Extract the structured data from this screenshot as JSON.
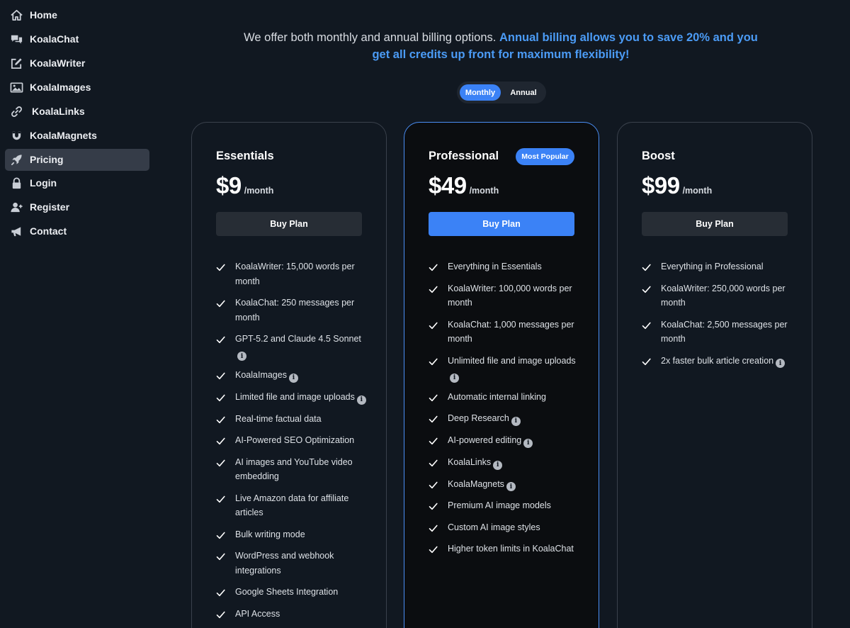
{
  "sidebar": {
    "items": [
      {
        "label": "Home",
        "icon": "home-icon"
      },
      {
        "label": "KoalaChat",
        "icon": "chat-icon"
      },
      {
        "label": "KoalaWriter",
        "icon": "edit-icon"
      },
      {
        "label": "KoalaImages",
        "icon": "image-icon"
      },
      {
        "label": "KoalaLinks",
        "icon": "link-icon"
      },
      {
        "label": "KoalaMagnets",
        "icon": "magnet-icon"
      },
      {
        "label": "Pricing",
        "icon": "rocket-icon",
        "active": true
      },
      {
        "label": "Login",
        "icon": "lock-icon"
      },
      {
        "label": "Register",
        "icon": "user-plus-icon"
      },
      {
        "label": "Contact",
        "icon": "megaphone-icon"
      }
    ]
  },
  "intro": {
    "text": "We offer both monthly and annual billing options.",
    "highlight": "Annual billing allows you to save 20% and you get all credits up front for maximum flexibility!"
  },
  "billing_toggle": {
    "monthly": "Monthly",
    "annual": "Annual",
    "selected": "Monthly"
  },
  "plans": [
    {
      "name": "Essentials",
      "price": "$9",
      "period": "/month",
      "button": "Buy Plan",
      "features": [
        {
          "text": "KoalaWriter: 15,000 words per month"
        },
        {
          "text": "KoalaChat: 250 messages per month"
        },
        {
          "text": "GPT-5.2 and Claude 4.5 Sonnet",
          "info": true
        },
        {
          "text": "KoalaImages",
          "info": true
        },
        {
          "text": "Limited file and image uploads",
          "info": true
        },
        {
          "text": "Real-time factual data"
        },
        {
          "text": "AI-Powered SEO Optimization"
        },
        {
          "text": "AI images and YouTube video embedding"
        },
        {
          "text": "Live Amazon data for affiliate articles"
        },
        {
          "text": "Bulk writing mode"
        },
        {
          "text": "WordPress and webhook integrations"
        },
        {
          "text": "Google Sheets Integration"
        },
        {
          "text": "API Access"
        }
      ]
    },
    {
      "name": "Professional",
      "badge": "Most Popular",
      "price": "$49",
      "period": "/month",
      "button": "Buy Plan",
      "features": [
        {
          "text": "Everything in Essentials"
        },
        {
          "text": "KoalaWriter: 100,000 words per month"
        },
        {
          "text": "KoalaChat: 1,000 messages per month"
        },
        {
          "text": "Unlimited file and image uploads",
          "info": true
        },
        {
          "text": "Automatic internal linking"
        },
        {
          "text": "Deep Research",
          "info": true
        },
        {
          "text": "AI-powered editing",
          "info": true
        },
        {
          "text": "KoalaLinks",
          "info": true
        },
        {
          "text": "KoalaMagnets",
          "info": true
        },
        {
          "text": "Premium AI image models"
        },
        {
          "text": "Custom AI image styles"
        },
        {
          "text": "Higher token limits in KoalaChat"
        }
      ]
    },
    {
      "name": "Boost",
      "price": "$99",
      "period": "/month",
      "button": "Buy Plan",
      "features": [
        {
          "text": "Everything in Professional"
        },
        {
          "text": "KoalaWriter: 250,000 words per month"
        },
        {
          "text": "KoalaChat: 2,500 messages per month"
        },
        {
          "text": "2x faster bulk article creation",
          "info": true
        }
      ]
    }
  ],
  "colors": {
    "background": "#111821",
    "accent": "#3b82f6",
    "highlight_text": "#4b9bf5"
  }
}
